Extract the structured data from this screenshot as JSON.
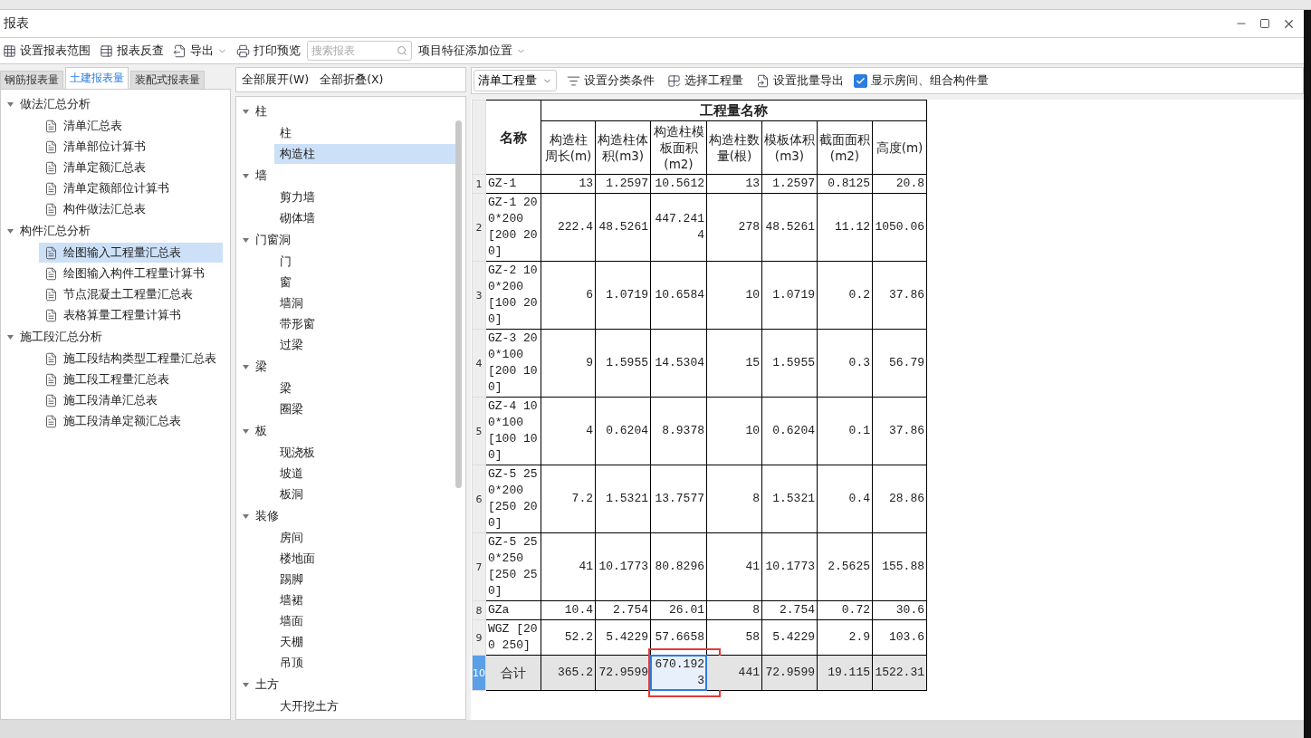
{
  "window": {
    "title": "报表"
  },
  "toolbar": {
    "items": [
      {
        "kind": "button",
        "label": "设置报表范围"
      },
      {
        "kind": "button",
        "label": "报表反查"
      },
      {
        "kind": "dropdown",
        "label": "导出"
      },
      {
        "kind": "button",
        "label": "打印预览"
      }
    ],
    "search": {
      "placeholder": "搜索报表"
    },
    "position_dropdown": {
      "label": "项目特征添加位置"
    }
  },
  "report_tabs": [
    {
      "label": "钢筋报表量",
      "selected": false
    },
    {
      "label": "土建报表量",
      "selected": true
    },
    {
      "label": "装配式报表量",
      "selected": false
    }
  ],
  "report_tree": [
    {
      "label": "做法汇总分析",
      "expanded": true,
      "children": [
        {
          "label": "清单汇总表",
          "selected": false
        },
        {
          "label": "清单部位计算书",
          "selected": false
        },
        {
          "label": "清单定额汇总表",
          "selected": false
        },
        {
          "label": "清单定额部位计算书",
          "selected": false
        },
        {
          "label": "构件做法汇总表",
          "selected": false
        }
      ]
    },
    {
      "label": "构件汇总分析",
      "expanded": true,
      "children": [
        {
          "label": "绘图输入工程量汇总表",
          "selected": true
        },
        {
          "label": "绘图输入构件工程量计算书",
          "selected": false
        },
        {
          "label": "节点混凝土工程量汇总表",
          "selected": false
        },
        {
          "label": "表格算量工程量计算书",
          "selected": false
        }
      ]
    },
    {
      "label": "施工段汇总分析",
      "expanded": true,
      "children": [
        {
          "label": "施工段结构类型工程量汇总表",
          "selected": false
        },
        {
          "label": "施工段工程量汇总表",
          "selected": false
        },
        {
          "label": "施工段清单汇总表",
          "selected": false
        },
        {
          "label": "施工段清单定额汇总表",
          "selected": false
        }
      ]
    }
  ],
  "component_panel": {
    "expand_all": "全部展开(W)",
    "collapse_all": "全部折叠(X)",
    "tree": [
      {
        "label": "柱",
        "expanded": true,
        "children": [
          {
            "label": "柱",
            "selected": false
          },
          {
            "label": "构造柱",
            "selected": true
          }
        ]
      },
      {
        "label": "墙",
        "expanded": true,
        "children": [
          {
            "label": "剪力墙",
            "selected": false
          },
          {
            "label": "砌体墙",
            "selected": false
          }
        ]
      },
      {
        "label": "门窗洞",
        "expanded": true,
        "children": [
          {
            "label": "门",
            "selected": false
          },
          {
            "label": "窗",
            "selected": false
          },
          {
            "label": "墙洞",
            "selected": false
          },
          {
            "label": "带形窗",
            "selected": false
          },
          {
            "label": "过梁",
            "selected": false
          }
        ]
      },
      {
        "label": "梁",
        "expanded": true,
        "children": [
          {
            "label": "梁",
            "selected": false
          },
          {
            "label": "圈梁",
            "selected": false
          }
        ]
      },
      {
        "label": "板",
        "expanded": true,
        "children": [
          {
            "label": "现浇板",
            "selected": false
          },
          {
            "label": "坡道",
            "selected": false
          },
          {
            "label": "板洞",
            "selected": false
          }
        ]
      },
      {
        "label": "装修",
        "expanded": true,
        "children": [
          {
            "label": "房间",
            "selected": false
          },
          {
            "label": "楼地面",
            "selected": false
          },
          {
            "label": "踢脚",
            "selected": false
          },
          {
            "label": "墙裙",
            "selected": false
          },
          {
            "label": "墙面",
            "selected": false
          },
          {
            "label": "天棚",
            "selected": false
          },
          {
            "label": "吊顶",
            "selected": false
          }
        ]
      },
      {
        "label": "土方",
        "expanded": true,
        "children": [
          {
            "label": "大开挖土方",
            "selected": false
          }
        ]
      }
    ]
  },
  "report_toolbar": {
    "quantity_dropdown": "清单工程量",
    "buttons": [
      "设置分类条件",
      "选择工程量",
      "设置批量导出"
    ],
    "show_rooms": {
      "label": "显示房间、组合构件量",
      "checked": true
    }
  },
  "table": {
    "name_header": "名称",
    "group_header": "工程量名称",
    "columns": [
      "构造柱周长(m)",
      "构造柱体积(m3)",
      "构造柱模板面积(m2)",
      "构造柱数量(根)",
      "模板体积(m3)",
      "截面面积(m2)",
      "高度(m)"
    ],
    "rows": [
      {
        "number": "1",
        "kind": "data",
        "selected": false,
        "name": "GZ-1",
        "cells": [
          {
            "text": "13",
            "selected": false
          },
          {
            "text": "1.2597",
            "selected": false
          },
          {
            "text": "10.5612",
            "selected": false
          },
          {
            "text": "13",
            "selected": false
          },
          {
            "text": "1.2597",
            "selected": false
          },
          {
            "text": "0.8125",
            "selected": false
          },
          {
            "text": "20.8",
            "selected": false
          }
        ]
      },
      {
        "number": "2",
        "kind": "data",
        "selected": false,
        "name": "GZ-1 200*200 [200 200]",
        "cells": [
          {
            "text": "222.4",
            "selected": false
          },
          {
            "text": "48.5261",
            "selected": false
          },
          {
            "text": "447.2414",
            "selected": false
          },
          {
            "text": "278",
            "selected": false
          },
          {
            "text": "48.5261",
            "selected": false
          },
          {
            "text": "11.12",
            "selected": false
          },
          {
            "text": "1050.06",
            "selected": false
          }
        ]
      },
      {
        "number": "3",
        "kind": "data",
        "selected": false,
        "name": "GZ-2 100*200 [100 200]",
        "cells": [
          {
            "text": "6",
            "selected": false
          },
          {
            "text": "1.0719",
            "selected": false
          },
          {
            "text": "10.6584",
            "selected": false
          },
          {
            "text": "10",
            "selected": false
          },
          {
            "text": "1.0719",
            "selected": false
          },
          {
            "text": "0.2",
            "selected": false
          },
          {
            "text": "37.86",
            "selected": false
          }
        ]
      },
      {
        "number": "4",
        "kind": "data",
        "selected": false,
        "name": "GZ-3 200*100 [200 100]",
        "cells": [
          {
            "text": "9",
            "selected": false
          },
          {
            "text": "1.5955",
            "selected": false
          },
          {
            "text": "14.5304",
            "selected": false
          },
          {
            "text": "15",
            "selected": false
          },
          {
            "text": "1.5955",
            "selected": false
          },
          {
            "text": "0.3",
            "selected": false
          },
          {
            "text": "56.79",
            "selected": false
          }
        ]
      },
      {
        "number": "5",
        "kind": "data",
        "selected": false,
        "name": "GZ-4 100*100 [100 100]",
        "cells": [
          {
            "text": "4",
            "selected": false
          },
          {
            "text": "0.6204",
            "selected": false
          },
          {
            "text": "8.9378",
            "selected": false
          },
          {
            "text": "10",
            "selected": false
          },
          {
            "text": "0.6204",
            "selected": false
          },
          {
            "text": "0.1",
            "selected": false
          },
          {
            "text": "37.86",
            "selected": false
          }
        ]
      },
      {
        "number": "6",
        "kind": "data",
        "selected": false,
        "name": "GZ-5 250*200 [250 200]",
        "cells": [
          {
            "text": "7.2",
            "selected": false
          },
          {
            "text": "1.5321",
            "selected": false
          },
          {
            "text": "13.7577",
            "selected": false
          },
          {
            "text": "8",
            "selected": false
          },
          {
            "text": "1.5321",
            "selected": false
          },
          {
            "text": "0.4",
            "selected": false
          },
          {
            "text": "28.86",
            "selected": false
          }
        ]
      },
      {
        "number": "7",
        "kind": "data",
        "selected": false,
        "name": "GZ-5 250*250 [250 250]",
        "cells": [
          {
            "text": "41",
            "selected": false
          },
          {
            "text": "10.1773",
            "selected": false
          },
          {
            "text": "80.8296",
            "selected": false
          },
          {
            "text": "41",
            "selected": false
          },
          {
            "text": "10.1773",
            "selected": false
          },
          {
            "text": "2.5625",
            "selected": false
          },
          {
            "text": "155.88",
            "selected": false
          }
        ]
      },
      {
        "number": "8",
        "kind": "data",
        "selected": false,
        "name": "GZa",
        "cells": [
          {
            "text": "10.4",
            "selected": false
          },
          {
            "text": "2.754",
            "selected": false
          },
          {
            "text": "26.01",
            "selected": false
          },
          {
            "text": "8",
            "selected": false
          },
          {
            "text": "2.754",
            "selected": false
          },
          {
            "text": "0.72",
            "selected": false
          },
          {
            "text": "30.6",
            "selected": false
          }
        ]
      },
      {
        "number": "9",
        "kind": "data",
        "selected": false,
        "name": "WGZ [200 250]",
        "cells": [
          {
            "text": "52.2",
            "selected": false
          },
          {
            "text": "5.4229",
            "selected": false
          },
          {
            "text": "57.6658",
            "selected": false
          },
          {
            "text": "58",
            "selected": false
          },
          {
            "text": "5.4229",
            "selected": false
          },
          {
            "text": "2.9",
            "selected": false
          },
          {
            "text": "103.6",
            "selected": false
          }
        ]
      },
      {
        "number": "10",
        "kind": "total",
        "selected": true,
        "name": "合计",
        "cells": [
          {
            "text": "365.2",
            "selected": false
          },
          {
            "text": "72.9599",
            "selected": false
          },
          {
            "text": "670.1923",
            "selected": true,
            "annotated": true
          },
          {
            "text": "441",
            "selected": false
          },
          {
            "text": "72.9599",
            "selected": false
          },
          {
            "text": "19.115",
            "selected": false
          },
          {
            "text": "1522.31",
            "selected": false
          }
        ]
      }
    ]
  }
}
